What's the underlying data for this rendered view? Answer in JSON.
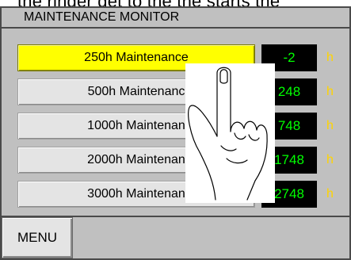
{
  "caption": "the ringer get to the the starts the",
  "title": "MAINTENANCE MONITOR",
  "rows": [
    {
      "label": "250h Maintenance",
      "value": "-2",
      "unit": "h",
      "active": true
    },
    {
      "label": "500h Maintenanc",
      "value": "248",
      "unit": "h",
      "active": false
    },
    {
      "label": "1000h Maintenan",
      "value": "748",
      "unit": "h",
      "active": false
    },
    {
      "label": "2000h Maintenan",
      "value": "1748",
      "unit": "h",
      "active": false
    },
    {
      "label": "3000h Maintenan",
      "value": "2748",
      "unit": "h",
      "active": false
    }
  ],
  "menu_label": "MENU",
  "colors": {
    "panel": "#c0c0c0",
    "active_button": "#ffff00",
    "value_text": "#00ff00",
    "unit_text": "#ffd400",
    "value_bg": "#000000"
  },
  "overlay_icon": "pointing-hand-icon"
}
